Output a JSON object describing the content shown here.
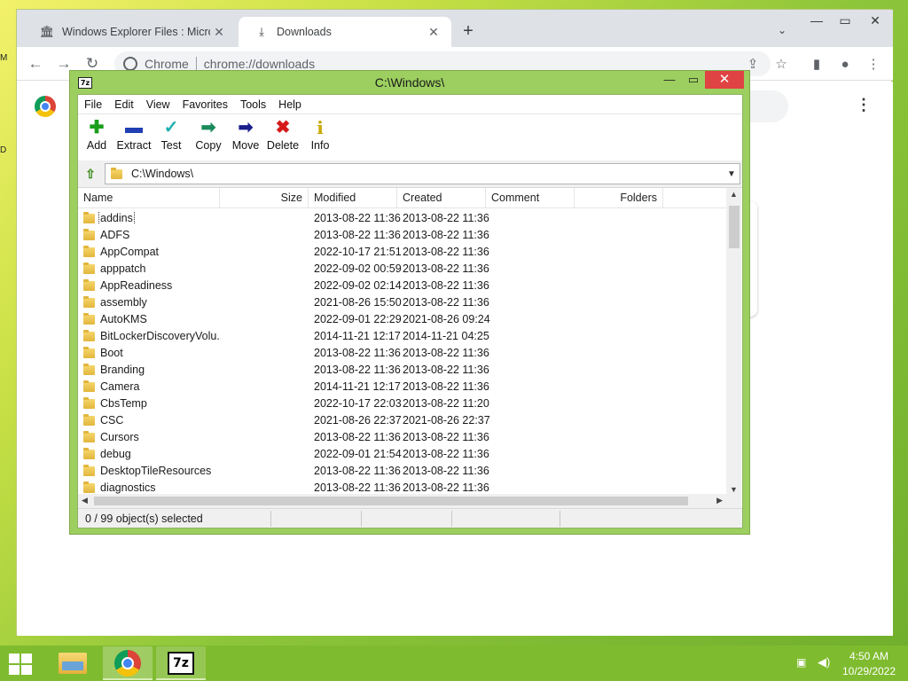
{
  "chrome": {
    "tabs": [
      {
        "title": "Windows Explorer Files : Microso",
        "icon": "museum-icon",
        "close": "✕"
      },
      {
        "title": "Downloads",
        "icon": "download-icon",
        "close": "✕"
      }
    ],
    "new_tab": "+",
    "tab_search": "⌄",
    "window_controls": {
      "minimize": "—",
      "maximize": "▭",
      "close": "✕"
    },
    "nav": {
      "back": "←",
      "forward": "→",
      "reload": "↻"
    },
    "omnibox": {
      "site_label": "Chrome",
      "url": "chrome://downloads"
    },
    "toolbar_icons": {
      "share": "⇪",
      "bookmark": "☆",
      "sidepanel": "▮",
      "profile": "●",
      "menu": "⋮"
    },
    "downloads_menu": "⋮"
  },
  "sevenzip": {
    "title": "C:\\Windows\\",
    "app_icon": "7z",
    "window_controls": {
      "minimize": "—",
      "maximize": "▭",
      "close": "✕"
    },
    "menu": [
      "File",
      "Edit",
      "View",
      "Favorites",
      "Tools",
      "Help"
    ],
    "toolbar": [
      {
        "label": "Add",
        "icon": "add-icon",
        "glyph": "✚",
        "color": "#1a9e1a"
      },
      {
        "label": "Extract",
        "icon": "extract-icon",
        "glyph": "▬",
        "color": "#1f3fb3"
      },
      {
        "label": "Test",
        "icon": "test-icon",
        "glyph": "✓",
        "color": "#1fb0b0"
      },
      {
        "label": "Copy",
        "icon": "copy-icon",
        "glyph": "➡",
        "color": "#1a8a5a"
      },
      {
        "label": "Move",
        "icon": "move-icon",
        "glyph": "➡",
        "color": "#1a1f8a"
      },
      {
        "label": "Delete",
        "icon": "delete-icon",
        "glyph": "✖",
        "color": "#d61a1a"
      },
      {
        "label": "Info",
        "icon": "info-icon",
        "glyph": "i",
        "color": "#c9a800"
      }
    ],
    "address": "C:\\Windows\\",
    "columns": {
      "name": "Name",
      "size": "Size",
      "modified": "Modified",
      "created": "Created",
      "comment": "Comment",
      "folders": "Folders"
    },
    "rows": [
      {
        "name": "addins",
        "modified": "2013-08-22 11:36",
        "created": "2013-08-22 11:36"
      },
      {
        "name": "ADFS",
        "modified": "2013-08-22 11:36",
        "created": "2013-08-22 11:36"
      },
      {
        "name": "AppCompat",
        "modified": "2022-10-17 21:51",
        "created": "2013-08-22 11:36"
      },
      {
        "name": "apppatch",
        "modified": "2022-09-02 00:59",
        "created": "2013-08-22 11:36"
      },
      {
        "name": "AppReadiness",
        "modified": "2022-09-02 02:14",
        "created": "2013-08-22 11:36"
      },
      {
        "name": "assembly",
        "modified": "2021-08-26 15:50",
        "created": "2013-08-22 11:36"
      },
      {
        "name": "AutoKMS",
        "modified": "2022-09-01 22:29",
        "created": "2021-08-26 09:24"
      },
      {
        "name": "BitLockerDiscoveryVolu...",
        "modified": "2014-11-21 12:17",
        "created": "2014-11-21 04:25"
      },
      {
        "name": "Boot",
        "modified": "2013-08-22 11:36",
        "created": "2013-08-22 11:36"
      },
      {
        "name": "Branding",
        "modified": "2013-08-22 11:36",
        "created": "2013-08-22 11:36"
      },
      {
        "name": "Camera",
        "modified": "2014-11-21 12:17",
        "created": "2013-08-22 11:36"
      },
      {
        "name": "CbsTemp",
        "modified": "2022-10-17 22:03",
        "created": "2013-08-22 11:20"
      },
      {
        "name": "CSC",
        "modified": "2021-08-26 22:37",
        "created": "2021-08-26 22:37"
      },
      {
        "name": "Cursors",
        "modified": "2013-08-22 11:36",
        "created": "2013-08-22 11:36"
      },
      {
        "name": "debug",
        "modified": "2022-09-01 21:54",
        "created": "2013-08-22 11:36"
      },
      {
        "name": "DesktopTileResources",
        "modified": "2013-08-22 11:36",
        "created": "2013-08-22 11:36"
      },
      {
        "name": "diagnostics",
        "modified": "2013-08-22 11:36",
        "created": "2013-08-22 11:36"
      }
    ],
    "status": "0 / 99 object(s) selected"
  },
  "taskbar": {
    "time": "4:50 AM",
    "date": "10/29/2022",
    "network_icon": "▣",
    "volume_icon": "◀)"
  },
  "desktop_edge": [
    "M",
    "D"
  ]
}
